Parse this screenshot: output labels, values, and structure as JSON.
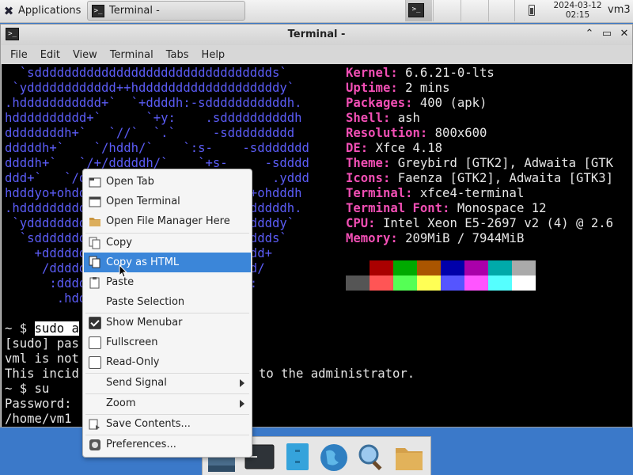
{
  "panel": {
    "applications_label": "Applications",
    "task_title": "Terminal -",
    "clock_date": "2024-03-12",
    "clock_time": "02:15",
    "user": "vm3"
  },
  "window": {
    "title": "Terminal -",
    "menu": [
      "File",
      "Edit",
      "View",
      "Terminal",
      "Tabs",
      "Help"
    ]
  },
  "terminal": {
    "ascii_art": [
      "  `sdddddddddddddddddddddddddddddddds`",
      " `ydddddddddddd++hdddddddddddddddddddy`",
      ".hddddddddddd+`  `+ddddh:-sdddddddddddh.",
      "hdddddddddd+`      `+y:    .sddddddddddh",
      "ddddddddh+`   `//`  `.`     -sddddddddd",
      "dddddh+`    `/hddh/`    `:s-    -sddddddd",
      "ddddh+`   `/+/dddddh/`    `+s-     -sdddd",
      "ddd+`   `/o` :dddddddh/`   `oy-     .yddd",
      "hdddyo+ohddyosdddddddddho+oydddy++ohdddh",
      ".hddddddddddddddddddddddddddddddddddddh.",
      " `yddddddddddddddddddddddddddddddddddy`",
      "  `sdddddddddddddddddddddddddddddddds`",
      "    +dddddddddddddddddddddddddddddd+",
      "     /dddddddddddddddddddddddddddd/",
      "      :dddddddddddddddddddddddddd:",
      "       .hddddddddddddddddddddddh."
    ],
    "sysinfo": [
      {
        "key": "Kernel",
        "value": "6.6.21-0-lts"
      },
      {
        "key": "Uptime",
        "value": "2 mins"
      },
      {
        "key": "Packages",
        "value": "400 (apk)"
      },
      {
        "key": "Shell",
        "value": "ash"
      },
      {
        "key": "Resolution",
        "value": "800x600"
      },
      {
        "key": "DE",
        "value": "Xfce 4.18"
      },
      {
        "key": "Theme",
        "value": "Greybird [GTK2], Adwaita [GTK"
      },
      {
        "key": "Icons",
        "value": "Faenza [GTK2], Adwaita [GTK3]"
      },
      {
        "key": "Terminal",
        "value": "xfce4-terminal"
      },
      {
        "key": "Terminal Font",
        "value": "Monospace 12"
      },
      {
        "key": "CPU",
        "value": "Intel Xeon E5-2697 v2 (4) @ 2.6"
      },
      {
        "key": "Memory",
        "value": "209MiB / 7944MiB"
      }
    ],
    "palette_top": [
      "#000000",
      "#aa0000",
      "#00aa00",
      "#aa5500",
      "#0000aa",
      "#aa00aa",
      "#00aaaa",
      "#aaaaaa"
    ],
    "palette_bottom": [
      "#555555",
      "#ff5555",
      "#55ff55",
      "#ffff55",
      "#5555ff",
      "#ff55ff",
      "#55ffff",
      "#ffffff"
    ],
    "prompt_line": "~ $ ",
    "selected_cmd": "sudo a",
    "output": [
      "[sudo] pas",
      "vml is not",
      "This incid",
      "~ $ su",
      "Password: ",
      "/home/vm1 "
    ],
    "output_tail": "to the administrator."
  },
  "context_menu": {
    "items": [
      {
        "label": "Open Tab",
        "icon": "tab-icon"
      },
      {
        "label": "Open Terminal",
        "icon": "terminal-icon"
      },
      {
        "label": "Open File Manager Here",
        "icon": "folder-icon"
      },
      {
        "label": "Copy",
        "icon": "copy-icon"
      },
      {
        "label": "Copy as HTML",
        "icon": "copy-html-icon"
      },
      {
        "label": "Paste",
        "icon": "paste-icon"
      },
      {
        "label": "Paste Selection",
        "icon": ""
      },
      {
        "label": "Show Menubar",
        "icon": "checkbox-checked"
      },
      {
        "label": "Fullscreen",
        "icon": "checkbox"
      },
      {
        "label": "Read-Only",
        "icon": "checkbox"
      },
      {
        "label": "Send Signal",
        "icon": ""
      },
      {
        "label": "Zoom",
        "icon": ""
      },
      {
        "label": "Save Contents...",
        "icon": "save-icon"
      },
      {
        "label": "Preferences...",
        "icon": "preferences-icon"
      }
    ],
    "highlighted_index": 4
  },
  "dock": {
    "icons": [
      "desktop-icon",
      "terminal-icon",
      "file-manager-icon",
      "web-browser-icon",
      "search-icon",
      "folder-icon"
    ]
  }
}
